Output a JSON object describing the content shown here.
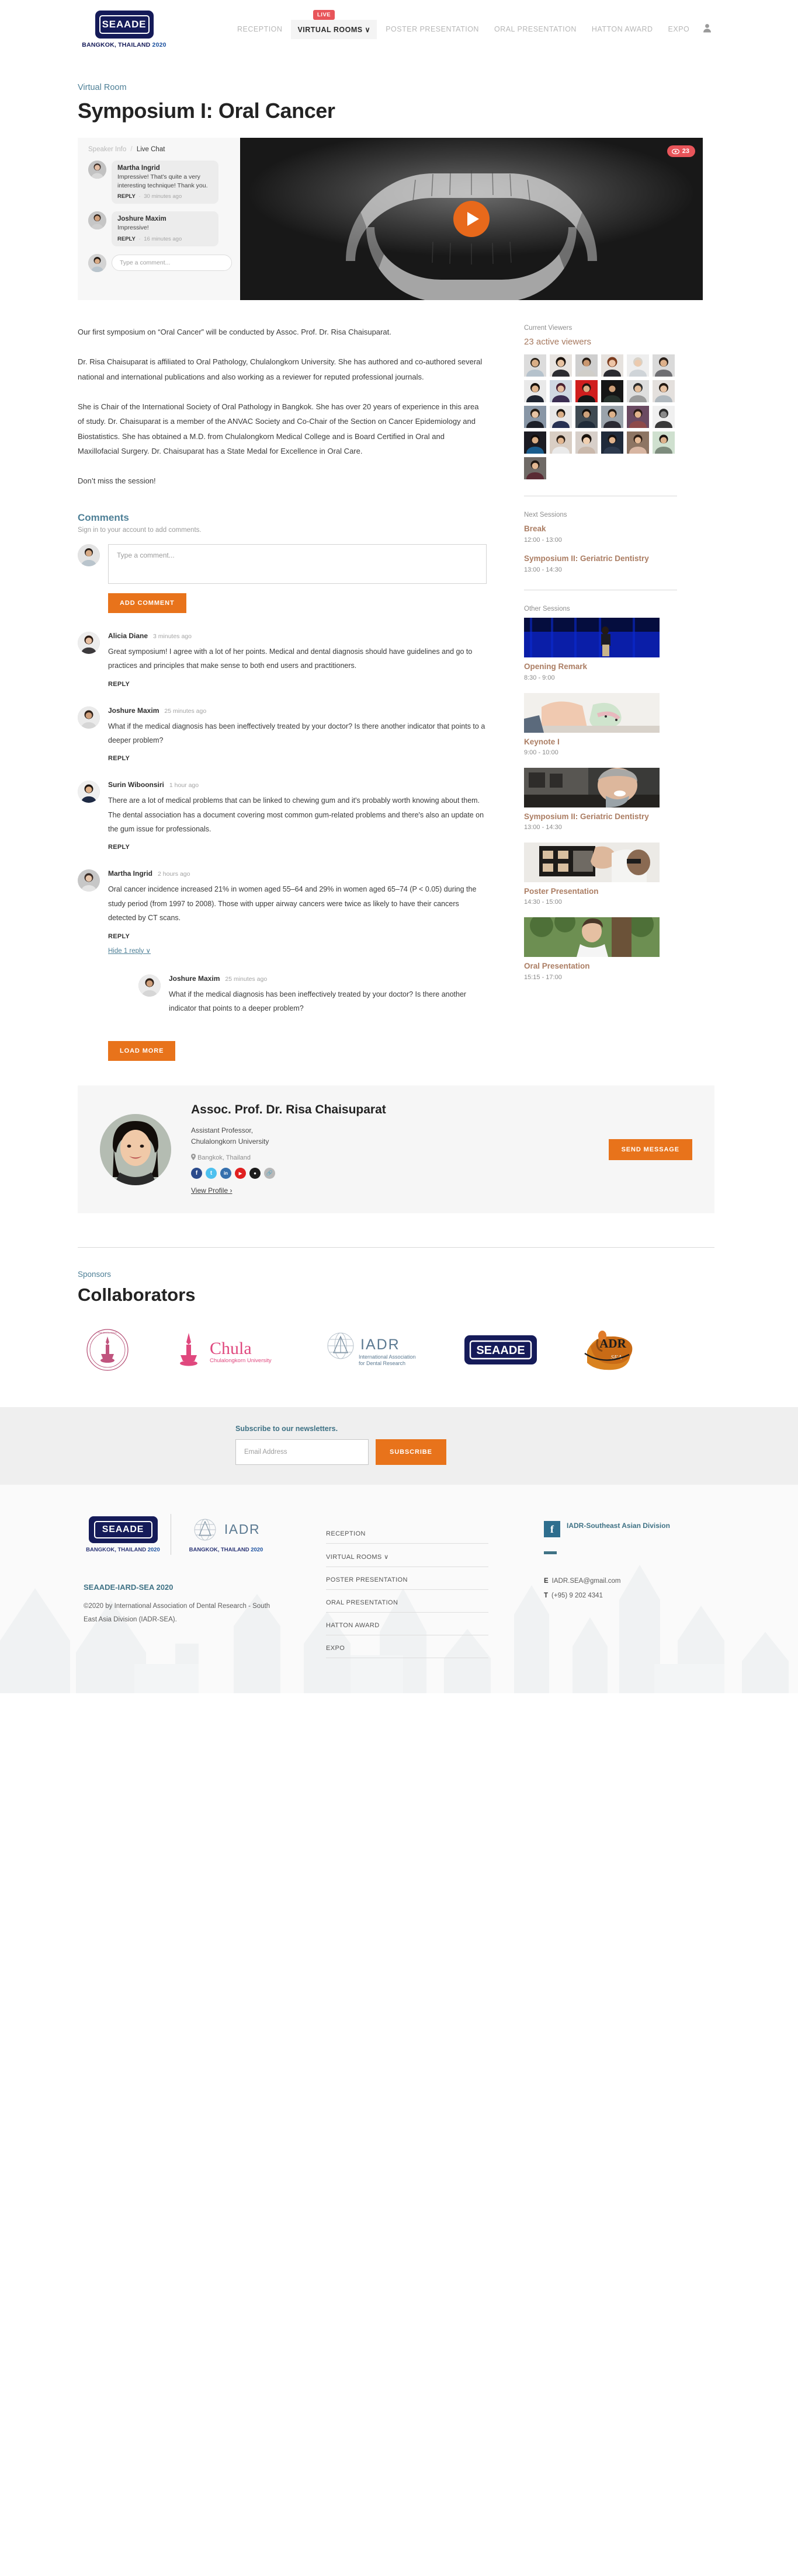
{
  "header": {
    "logo_text": "SEAADE",
    "logo_sub_pre": "BANGKOK, THAILAND ",
    "logo_sub_year": "2020",
    "live_badge": "LIVE",
    "nav": [
      {
        "label": "RECEPTION",
        "active": false
      },
      {
        "label": "VIRTUAL ROOMS ∨",
        "active": true
      },
      {
        "label": "POSTER PRESENTATION",
        "active": false
      },
      {
        "label": "ORAL PRESENTATION",
        "active": false
      },
      {
        "label": "HATTON AWARD",
        "active": false
      },
      {
        "label": "EXPO",
        "active": false
      }
    ]
  },
  "page": {
    "eyebrow": "Virtual Room",
    "title": "Symposium I: Oral Cancer"
  },
  "chat": {
    "tab_speaker": "Speaker Info",
    "tab_sep": "/",
    "tab_live": "Live Chat",
    "messages": [
      {
        "name": "Martha Ingrid",
        "text": "Impressive! That's quite a very interesting technique! Thank you.",
        "reply": "REPLY",
        "when": "30 minutes ago"
      },
      {
        "name": "Joshure Maxim",
        "text": "Impressive!",
        "reply": "REPLY",
        "when": "16 minutes ago"
      }
    ],
    "input_placeholder": "Type a comment..."
  },
  "video": {
    "viewer_count": "23"
  },
  "article": {
    "paragraphs": [
      "Our first symposium on “Oral Cancer” will be conducted by Assoc. Prof. Dr. Risa Chaisuparat.",
      "Dr. Risa Chaisuparat is affiliated to Oral Pathology, Chulalongkorn University. She has authored and co-authored several national and international publications and also working as a reviewer for reputed professional journals.",
      "She is Chair of the International Society of Oral Pathology in Bangkok. She has over 20 years of experience in this area of study. Dr. Chaisuparat is a member of the ANVAC Society and Co-Chair of the Section on Cancer Epidemiology and Biostatistics. She has obtained a M.D. from Chulalongkorn Medical College and is Board Certified in Oral and Maxillofacial Surgery. Dr. Chaisuparat has a State Medal for Excellence in Oral Care.",
      "Don’t miss the session!"
    ]
  },
  "comments": {
    "heading": "Comments",
    "subheading": "Sign in to your account to add comments.",
    "input_placeholder": "Type a comment...",
    "add_button": "ADD COMMENT",
    "load_more": "LOAD MORE",
    "items": [
      {
        "name": "Alicia Diane",
        "when": "3 minutes ago",
        "text": "Great symposium! I agree with a lot of her points. Medical and dental diagnosis should have guidelines and go to practices and principles that make sense to both end users and practitioners.",
        "reply": "REPLY"
      },
      {
        "name": "Joshure Maxim",
        "when": "25 minutes ago",
        "text": "What if the medical diagnosis has been ineffectively treated by your doctor? Is there another indicator that points to a deeper problem?",
        "reply": "REPLY"
      },
      {
        "name": "Surin Wiboonsiri",
        "when": "1 hour ago",
        "text": "There are a lot of medical problems that can be linked to chewing gum and it's probably worth knowing about them. The dental association has a document covering most common gum-related problems and there's also an update on the gum issue for professionals.",
        "reply": "REPLY"
      },
      {
        "name": "Martha Ingrid",
        "when": "2 hours ago",
        "text": "Oral cancer incidence increased 21% in women aged 55–64 and 29% in women aged 65–74 (P < 0.05) during the study period (from 1997 to 2008). Those with upper airway cancers were twice as likely to have their cancers detected by CT scans.",
        "reply": "REPLY",
        "hide_replies": "Hide 1 reply ∨",
        "replies": [
          {
            "name": "Joshure Maxim",
            "when": "25 minutes ago",
            "text": "What if the medical diagnosis has been ineffectively treated by your doctor? Is there another indicator that points to a deeper problem?"
          }
        ]
      }
    ]
  },
  "sidebar": {
    "viewers_label": "Current Viewers",
    "viewers_count": "23 active viewers",
    "next_label": "Next Sessions",
    "next_sessions": [
      {
        "name": "Break",
        "time": "12:00 - 13:00"
      },
      {
        "name": "Symposium II: Geriatric Dentistry",
        "time": "13:00 - 14:30"
      }
    ],
    "other_label": "Other Sessions",
    "other_sessions": [
      {
        "name": "Opening Remark",
        "time": "8:30 - 9:00"
      },
      {
        "name": "Keynote I",
        "time": "9:00 - 10:00"
      },
      {
        "name": "Symposium II: Geriatric Dentistry",
        "time": "13:00 - 14:30"
      },
      {
        "name": "Poster Presentation",
        "time": "14:30 - 15:00"
      },
      {
        "name": "Oral Presentation",
        "time": "15:15 - 17:00"
      }
    ]
  },
  "speaker": {
    "name": "Assoc. Prof. Dr. Risa Chaisuparat",
    "role": "Assistant Professor,\nChulalongkorn University",
    "location": "Bangkok, Thailand",
    "view_profile": "View Profile ›",
    "send_message": "SEND MESSAGE",
    "socials": [
      {
        "icon": "facebook-icon",
        "glyph": "f",
        "color": "#2b4a8b"
      },
      {
        "icon": "twitter-icon",
        "glyph": "t",
        "color": "#4ec1ef"
      },
      {
        "icon": "linkedin-icon",
        "glyph": "in",
        "color": "#3670ad"
      },
      {
        "icon": "youtube-icon",
        "glyph": "▶",
        "color": "#e02020"
      },
      {
        "icon": "github-icon",
        "glyph": "●",
        "color": "#1c1c1c"
      },
      {
        "icon": "link-icon",
        "glyph": "⚭",
        "color": "#b8b8b8"
      }
    ]
  },
  "sponsors": {
    "eyebrow": "Sponsors",
    "title": "Collaborators",
    "logos": [
      {
        "name": "dental-association-thailand-logo",
        "text": ""
      },
      {
        "name": "chula-logo",
        "text": "Chula",
        "sub": "Chulalongkorn University"
      },
      {
        "name": "iadr-logo",
        "text": "IADR",
        "sub": "International Association\nfor Dental Research"
      },
      {
        "name": "seaade-logo",
        "text": "SEAADE"
      },
      {
        "name": "iadr-sea-logo",
        "text": "ADR"
      }
    ]
  },
  "newsletter": {
    "title": "Subscribe to our newsletters.",
    "placeholder": "Email Address",
    "button": "SUBSCRIBE"
  },
  "footer": {
    "logo_a_text": "SEAADE",
    "logo_a_cap_pre": "BANGKOK, THAILAND ",
    "logo_a_cap_year": "2020",
    "logo_b_text": "IADR",
    "logo_b_cap_pre": "BANGKOK, THAILAND ",
    "logo_b_cap_year": "2020",
    "brand": "SEAADE-IARD-SEA 2020",
    "copyright": "©2020 by International Association of Dental Research - South East Asia Division (IADR-SEA).",
    "links": [
      "RECEPTION",
      "VIRTUAL ROOMS ∨",
      "POSTER PRESENTATION",
      "ORAL PRESENTATION",
      "HATTON AWARD",
      "EXPO"
    ],
    "facebook_name": "IADR-Southeast Asian Division",
    "email_label": "E",
    "email": "IADR.SEA@gmail.com",
    "phone_label": "T",
    "phone": "(+95) 9 202 4341"
  }
}
